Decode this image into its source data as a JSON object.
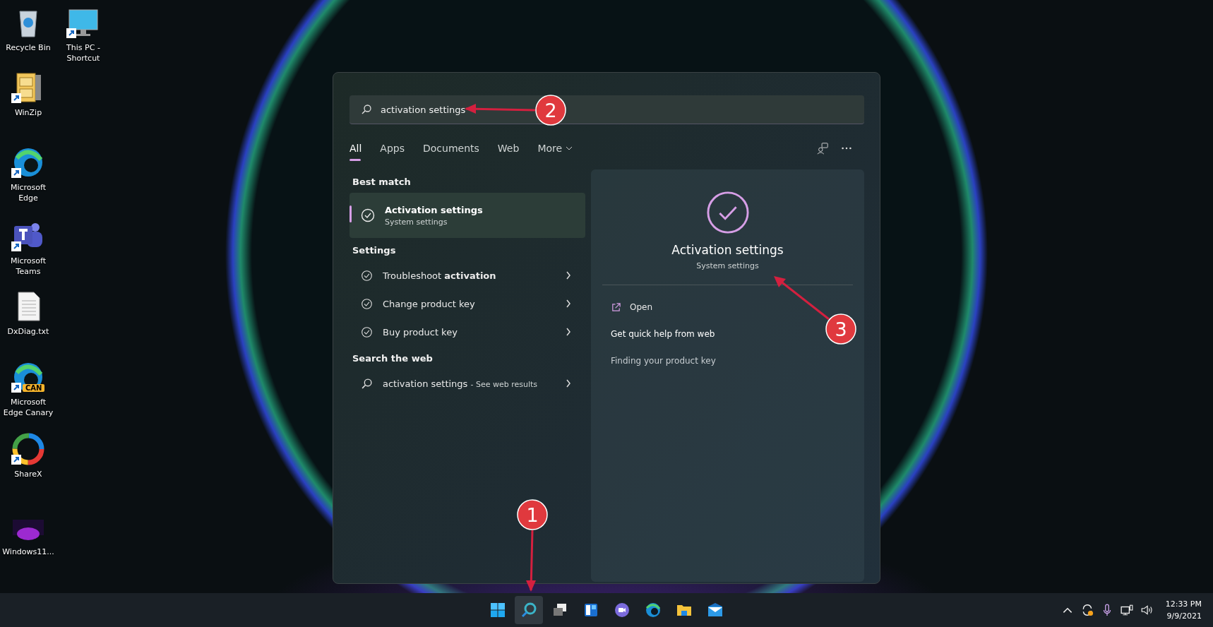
{
  "desktop_icons": [
    {
      "kind": "recycle",
      "label": "Recycle Bin",
      "shortcut": false
    },
    {
      "kind": "pc",
      "label": "This PC - Shortcut",
      "shortcut": true
    },
    {
      "kind": "winzip",
      "label": "WinZip",
      "shortcut": true
    },
    {
      "kind": "edge",
      "label": "Microsoft Edge",
      "shortcut": true
    },
    {
      "kind": "teams",
      "label": "Microsoft Teams",
      "shortcut": true
    },
    {
      "kind": "text",
      "label": "DxDiag.txt",
      "shortcut": false
    },
    {
      "kind": "canary",
      "label": "Microsoft Edge Canary",
      "badge": "CAN",
      "shortcut": true
    },
    {
      "kind": "sharex",
      "label": "ShareX",
      "shortcut": true
    },
    {
      "kind": "image",
      "label": "Windows11...",
      "shortcut": false
    }
  ],
  "search_panel": {
    "query": "activation settings",
    "tabs": [
      {
        "label": "All",
        "selected": true,
        "dropdown": false
      },
      {
        "label": "Apps",
        "selected": false,
        "dropdown": false
      },
      {
        "label": "Documents",
        "selected": false,
        "dropdown": false
      },
      {
        "label": "Web",
        "selected": false,
        "dropdown": false
      },
      {
        "label": "More",
        "selected": false,
        "dropdown": true
      }
    ],
    "best_match": {
      "heading": "Best match",
      "title": "Activation settings",
      "subtitle": "System settings",
      "selected": true
    },
    "settings": {
      "heading": "Settings",
      "items": [
        {
          "text": "Troubleshoot **activation**"
        },
        {
          "text": "Change product key"
        },
        {
          "text": "Buy product key"
        }
      ]
    },
    "web": {
      "heading": "Search the web",
      "query": "activation settings",
      "hint": "- See web results"
    },
    "preview": {
      "title": "Activation settings",
      "subtitle": "System settings",
      "actions": [
        {
          "kind": "open",
          "label": "Open"
        },
        {
          "kind": "heading",
          "label": "Get quick help from web"
        },
        {
          "kind": "link",
          "label": "Finding your product key"
        }
      ]
    }
  },
  "taskbar": {
    "apps": [
      {
        "kind": "start",
        "active": false
      },
      {
        "kind": "search",
        "active": true
      },
      {
        "kind": "taskview",
        "active": false
      },
      {
        "kind": "widgets",
        "active": false
      },
      {
        "kind": "chat",
        "active": false
      },
      {
        "kind": "edge",
        "active": false
      },
      {
        "kind": "explorer",
        "active": false
      },
      {
        "kind": "mail",
        "active": false
      }
    ],
    "clock": {
      "time": "12:33 PM",
      "date": "9/9/2021"
    }
  },
  "annotations": [
    {
      "label": "1"
    },
    {
      "label": "2"
    },
    {
      "label": "3"
    }
  ]
}
